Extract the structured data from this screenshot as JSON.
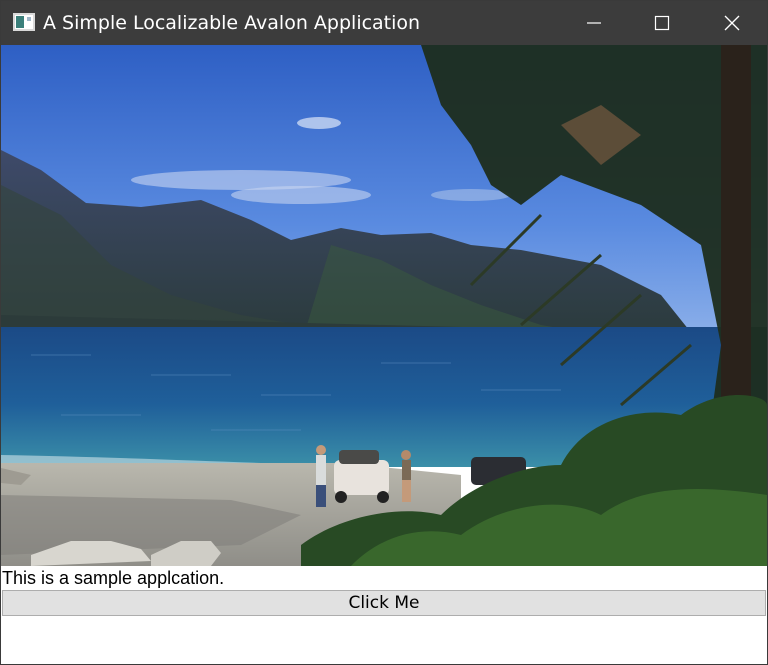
{
  "window": {
    "title": "A Simple Localizable Avalon Application",
    "icons": {
      "app": "app-window-icon",
      "minimize": "minimize-icon",
      "maximize": "maximize-icon",
      "close": "close-icon"
    }
  },
  "image": {
    "subject": "lake-mountain-landscape-photo"
  },
  "content": {
    "caption": "This is a sample applcation.",
    "button_label": "Click Me"
  },
  "colors": {
    "titlebar": "#3c3c3c",
    "button_bg": "#e1e1e1",
    "button_border": "#adadad"
  }
}
